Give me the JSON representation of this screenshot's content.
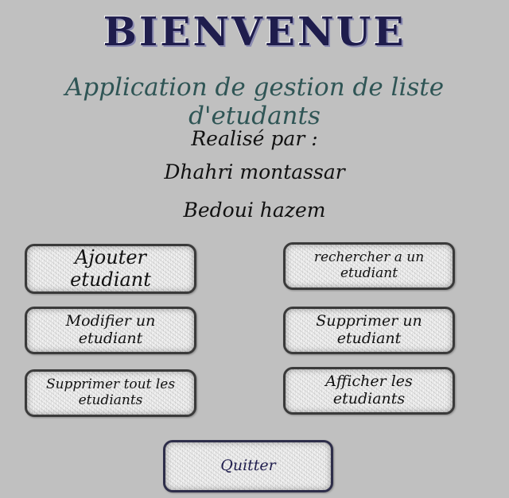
{
  "header": {
    "title": "BIENVENUE",
    "subtitle": "Application de gestion de liste d'etudants"
  },
  "credits": {
    "by_label": "Realisé par :",
    "author_1": "Dhahri montassar",
    "author_2": "Bedoui hazem"
  },
  "buttons": {
    "add": "Ajouter etudiant",
    "search": "rechercher a un etudiant",
    "edit": "Modifier un etudiant",
    "delete": "Supprimer un etudiant",
    "delete_all": "Supprimer tout les etudiants",
    "show": "Afficher les etudiants",
    "quit": "Quitter"
  },
  "colors": {
    "background": "#c0c0c0",
    "title": "#1f1d4d",
    "subtitle": "#2f5555"
  }
}
